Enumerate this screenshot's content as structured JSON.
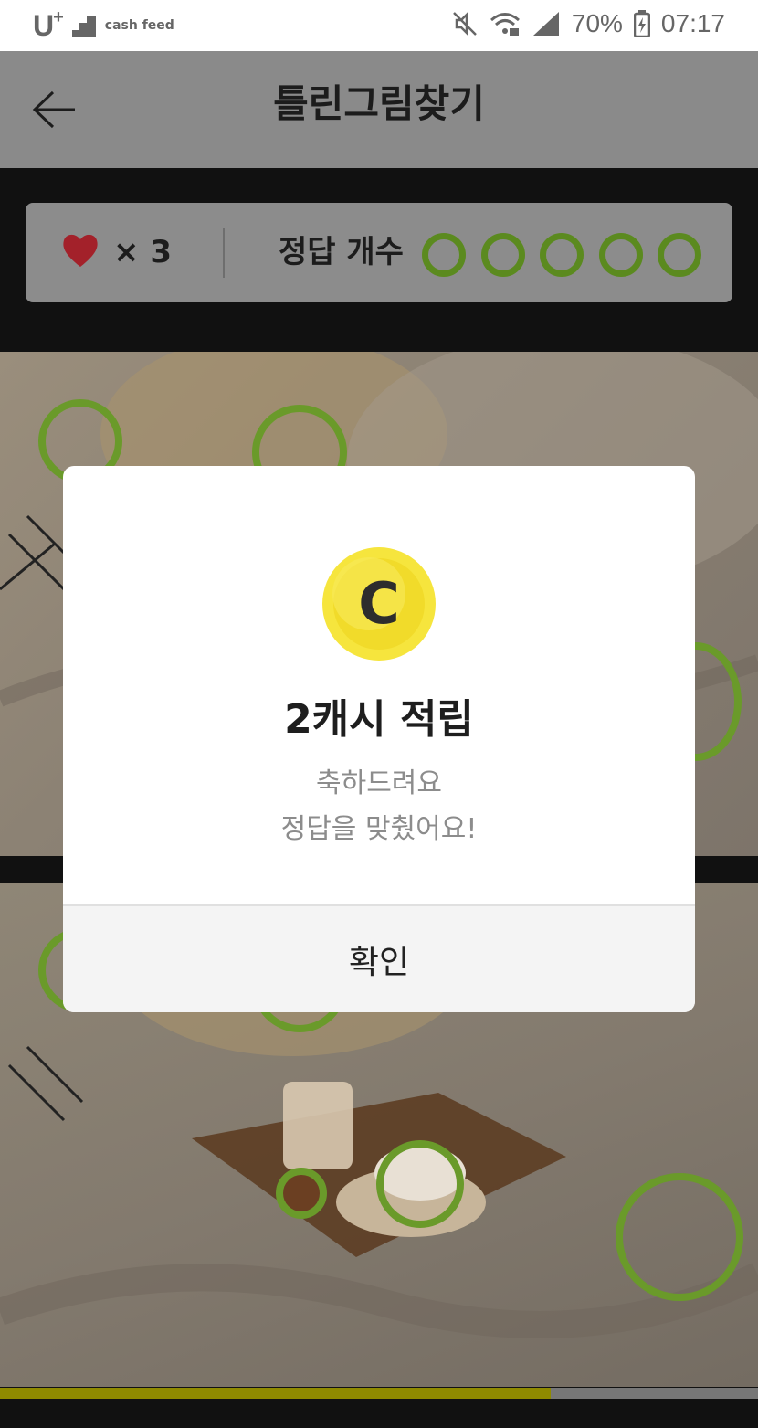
{
  "status_bar": {
    "carrier": "U",
    "carrier_sup": "+",
    "app_badge": "cash feed",
    "battery": "70%",
    "time": "07:17"
  },
  "header": {
    "title": "틀린그림찾기",
    "back_icon": "arrow-left-icon"
  },
  "score": {
    "heart_icon": "heart-icon",
    "lives_text": "× 3",
    "answers_label": "정답 개수",
    "answer_slots": 5,
    "ring_color": "#5b8a1f"
  },
  "game": {
    "progress_fraction": 0.727,
    "progress_color": "#8f8a00",
    "ring_color": "#6a9a2a"
  },
  "dialog": {
    "coin_icon": "coin-icon",
    "coin_letter": "C",
    "reward": "2캐시 적립",
    "message_line1": "축하드려요",
    "message_line2": "정답을 맞췄어요!",
    "confirm_label": "확인"
  }
}
